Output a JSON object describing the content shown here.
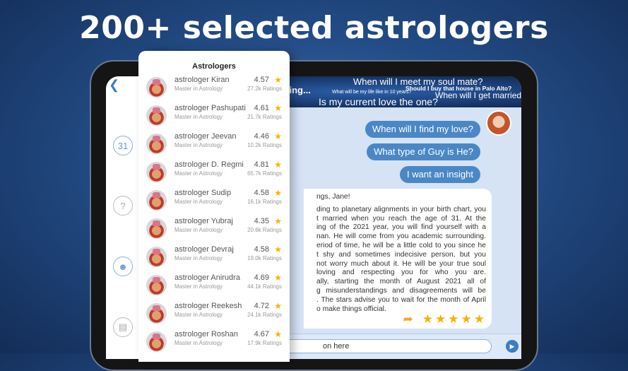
{
  "headline": "200+ selected astrologers",
  "sidebar": {
    "back_icon": "chevron-left-icon",
    "icons": [
      "calendar-icon",
      "help-icon",
      "users-icon",
      "chat-icon"
    ],
    "calendar_day": "31"
  },
  "banner": {
    "line1": "When will I meet my soul mate?",
    "line2": "Should I buy that house in Palo Alto?",
    "line3": "ything...",
    "line4": "What will be my life like in 10 years?",
    "line5": "When will I get married?",
    "line6": "Is my current love the one?"
  },
  "chat": {
    "questions": [
      "When will I find my love?",
      "What type of Guy is He?",
      "I want an insight"
    ],
    "reply_lines": [
      "ngs, Jane!",
      "ding to planetary alignments in your birth chart, you",
      "t married when you reach the age of 31. At the",
      "ing of the 2021 year, you will find yourself with a",
      "nan. He will come from you academic surrounding.",
      "eriod of time, he will be a little cold to you since he",
      "t shy and sometimes indecisive person, but you",
      "not worry much about it. He will be your true soul",
      "loving and respecting you for who you are.",
      "ally, starting the month of August 2021 all of",
      "g misunderstandings and disagreements  will be",
      ". The stars advise you to wait for the month of April",
      "o make things official."
    ],
    "rating_stars": 5,
    "input_placeholder": "on here"
  },
  "colors": {
    "accent": "#4a87c5",
    "star": "#f5b301"
  },
  "panel": {
    "title": "Astrologers",
    "items": [
      {
        "name": "astrologer Kiran",
        "subtitle": "Master in Astrology",
        "rating": "4.57",
        "count": "27.2k Ratings"
      },
      {
        "name": "astrologer Pashupati",
        "subtitle": "Master in Astrology",
        "rating": "4.61",
        "count": "21.7k Ratings"
      },
      {
        "name": "astrologer Jeevan",
        "subtitle": "Master in Astrology",
        "rating": "4.46",
        "count": "10.2k Ratings"
      },
      {
        "name": "astrologer D. Regmi",
        "subtitle": "Master in Astrology",
        "rating": "4.81",
        "count": "65.7k Ratings"
      },
      {
        "name": "astrologer Sudip",
        "subtitle": "Master in Astrology",
        "rating": "4.58",
        "count": "16.1k Ratings"
      },
      {
        "name": "astrologer Yubraj",
        "subtitle": "Master in Astrology",
        "rating": "4.35",
        "count": "20.6k Ratings"
      },
      {
        "name": "astrologer Devraj",
        "subtitle": "Master in Astrology",
        "rating": "4.58",
        "count": "19.0k Ratings"
      },
      {
        "name": "astrologer Anirudra",
        "subtitle": "Master in Astrology",
        "rating": "4.69",
        "count": "44.1k Ratings"
      },
      {
        "name": "astrologer Reekesh",
        "subtitle": "Master in Astrology",
        "rating": "4.72",
        "count": "24.1k Ratings"
      },
      {
        "name": "astrologer Roshan",
        "subtitle": "Master in Astrology",
        "rating": "4.67",
        "count": "17.9k Ratings"
      }
    ]
  }
}
